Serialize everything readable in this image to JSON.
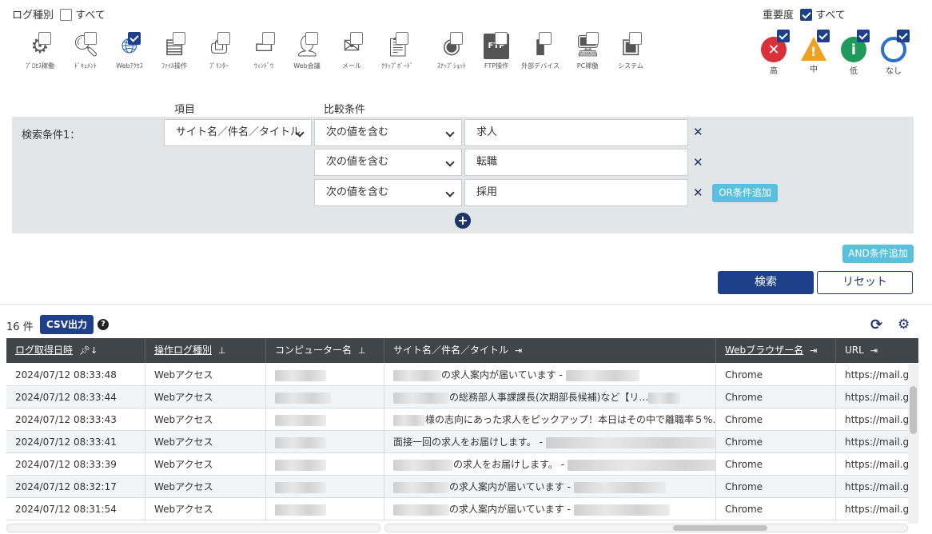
{
  "filter": {
    "log_type_label": "ログ種別",
    "all_label": "すべて",
    "severity_label": "重要度",
    "severity_all_label": "すべて",
    "log_types": [
      {
        "label": "ﾌﾟﾛｾｽ稼働",
        "icon": "process-icon",
        "checked": false
      },
      {
        "label": "ﾄﾞｷｭﾒﾝﾄ",
        "icon": "document-icon",
        "checked": false
      },
      {
        "label": "Webｱｸｾｽ",
        "icon": "globe-icon",
        "checked": true
      },
      {
        "label": "ﾌｧｲﾙ操作",
        "icon": "file-icon",
        "checked": false
      },
      {
        "label": "ﾌﾟﾘﾝﾀｰ",
        "icon": "printer-icon",
        "checked": false
      },
      {
        "label": "ｳｨﾝﾄﾞｳ",
        "icon": "window-icon",
        "checked": false
      },
      {
        "label": "Web会議",
        "icon": "meeting-icon",
        "checked": false
      },
      {
        "label": "メール",
        "icon": "mail-icon",
        "checked": false
      },
      {
        "label": "ｸﾘｯﾌﾟﾎﾞｰﾄﾞ",
        "icon": "clipboard-icon",
        "checked": false
      },
      {
        "label": "ｽﾅｯﾌﾟｼｮｯﾄ",
        "icon": "camera-icon",
        "checked": false
      },
      {
        "label": "FTP操作",
        "icon": "ftp-icon",
        "checked": false
      },
      {
        "label": "外部デバイス",
        "icon": "usb-icon",
        "checked": false
      },
      {
        "label": "PC稼働",
        "icon": "pc-clock-icon",
        "checked": false
      },
      {
        "label": "システム",
        "icon": "system-icon",
        "checked": false
      }
    ],
    "severities": [
      {
        "label": "高",
        "symbol": "✕",
        "color": "#d9303a"
      },
      {
        "label": "中",
        "symbol": "!",
        "color": "#f0a020"
      },
      {
        "label": "低",
        "symbol": "i",
        "color": "#1f9a5a"
      },
      {
        "label": "なし",
        "symbol": "",
        "color": "#2d6fc8"
      }
    ]
  },
  "search": {
    "item_header": "項目",
    "compare_header": "比較条件",
    "condition_label": "検索条件1：",
    "field_select": "サイト名／件名／タイトル",
    "conditions": [
      {
        "op": "次の値を含む",
        "value": "求人"
      },
      {
        "op": "次の値を含む",
        "value": "転職"
      },
      {
        "op": "次の値を含む",
        "value": "採用"
      }
    ],
    "or_button": "OR条件追加",
    "and_button": "AND条件追加",
    "search_button": "検索",
    "reset_button": "リセット"
  },
  "results": {
    "count": "16 件",
    "csv_button": "CSV出力",
    "columns": [
      "ログ取得日時",
      "操作ログ種別",
      "コンピューター名",
      "サイト名／件名／タイトル",
      "Webブラウザー名",
      "URL"
    ],
    "rows": [
      {
        "time": "2024/07/12 08:33:48",
        "type": "Webアクセス",
        "title": "の求人案内が届いています - ",
        "browser": "Chrome",
        "url": "https://mail.go"
      },
      {
        "time": "2024/07/12 08:33:44",
        "type": "Webアクセス",
        "title": "の総務部人事課課長(次期部長候補)など【リ…",
        "browser": "Chrome",
        "url": "https://mail.go"
      },
      {
        "time": "2024/07/12 08:33:43",
        "type": "Webアクセス",
        "title": "様の志向にあった求人をピックアップ！本日はその中で離職率５%…",
        "browser": "Chrome",
        "url": "https://mail.go"
      },
      {
        "time": "2024/07/12 08:33:41",
        "type": "Webアクセス",
        "title": "面接一回の求人をお届けします。 - ",
        "browser": "Chrome",
        "url": "https://mail.go"
      },
      {
        "time": "2024/07/12 08:33:39",
        "type": "Webアクセス",
        "title": "の求人をお届けします。 - ",
        "browser": "Chrome",
        "url": "https://mail.go"
      },
      {
        "time": "2024/07/12 08:32:17",
        "type": "Webアクセス",
        "title": "の求人案内が届いています - ",
        "browser": "Chrome",
        "url": "https://mail.go"
      },
      {
        "time": "2024/07/12 08:31:54",
        "type": "Webアクセス",
        "title": "の求人案内が届いています - ",
        "browser": "Chrome",
        "url": "https://mail.go"
      }
    ]
  }
}
